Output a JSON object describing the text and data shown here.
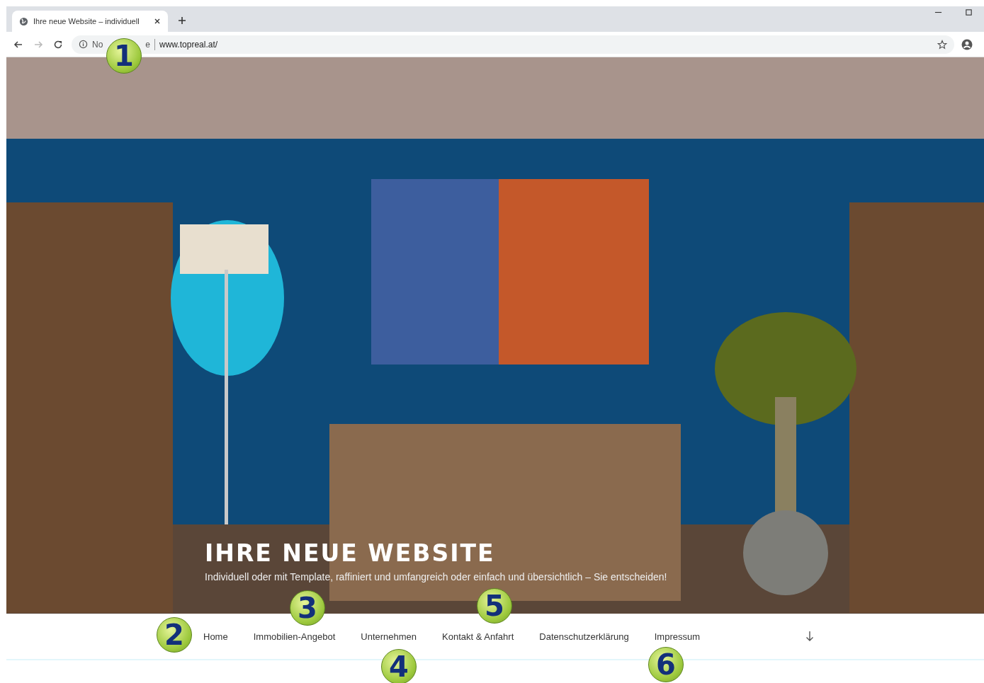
{
  "browser": {
    "tab_title": "Ihre neue Website – individuell",
    "security_text": "No",
    "security_text_end": "e",
    "url": "www.topreal.at/"
  },
  "hero": {
    "kind": "picture",
    "title": "IHRE NEUE WEBSITE",
    "subtitle": "Individuell oder mit Template, raffiniert und umfangreich oder einfach und übersichtlich – Sie entscheiden!"
  },
  "nav": {
    "items": [
      {
        "label": "Home"
      },
      {
        "label": "Immobilien-Angebot"
      },
      {
        "label": "Unternehmen"
      },
      {
        "label": "Kontakt & Anfahrt"
      },
      {
        "label": "Datenschutzerklärung"
      },
      {
        "label": "Impressum"
      }
    ]
  },
  "callouts": [
    {
      "label": "1"
    },
    {
      "label": "2"
    },
    {
      "label": "3"
    },
    {
      "label": "4"
    },
    {
      "label": "5"
    },
    {
      "label": "6"
    }
  ]
}
